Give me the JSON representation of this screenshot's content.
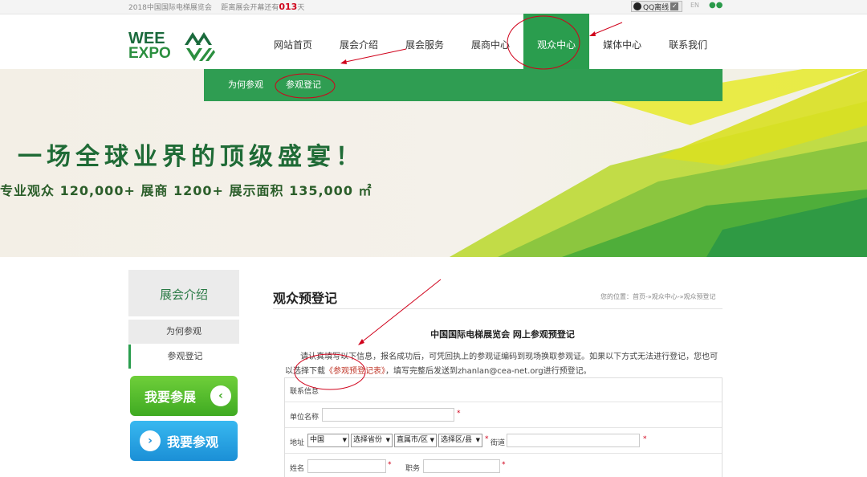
{
  "topbar": {
    "site_name": "2018中国国际电梯展览会",
    "countdown_prefix": "距离展会开幕还有",
    "countdown_value": "013",
    "countdown_suffix": "天",
    "qq_label": "QQ离线",
    "lang_en": "EN"
  },
  "logo": {
    "line1": "WEE",
    "line2": "EXPO"
  },
  "nav": {
    "items": [
      {
        "label": "网站首页"
      },
      {
        "label": "展会介绍"
      },
      {
        "label": "展会服务"
      },
      {
        "label": "展商中心"
      },
      {
        "label": "观众中心",
        "active": true
      },
      {
        "label": "媒体中心"
      },
      {
        "label": "联系我们"
      }
    ]
  },
  "subnav": {
    "items": [
      {
        "label": "为何参观"
      },
      {
        "label": "参观登记"
      }
    ]
  },
  "banner": {
    "slogan": "一场全球业界的顶级盛宴！",
    "stats": "专业观众 120,000+  展商 1200+  展示面积 135,000 ㎡"
  },
  "sidebar": {
    "title": "展会介绍",
    "items": [
      {
        "label": "为何参观"
      },
      {
        "label": "参观登记",
        "active": true
      }
    ],
    "btn_exhibit": "我要参展",
    "btn_visit": "我要参观"
  },
  "main": {
    "title": "观众预登记",
    "breadcrumb": "您的位置：首页-»观众中心-»观众预登记",
    "form_heading": "中国国际电梯展览会 网上参观预登记",
    "intro_part1": "请认真填写以下信息，报名成功后，可凭回执上的参观证编码到现场换取参观证。如果以下方式无法进行登记，您也可以选择下载",
    "intro_link": "《参观预登记表》",
    "intro_part2": "，填写完整后发送到zhanlan@cea-net.org进行预登记。"
  },
  "form": {
    "section_label": "联系信息",
    "company_label": "单位名称",
    "address_label": "地址",
    "country_value": "中国",
    "province_value": "选择省份",
    "city_value": "直属市/区",
    "district_value": "选择区/县",
    "street_label": "街道",
    "name_label": "姓名",
    "position_label": "职务",
    "required_mark": "*"
  },
  "colors": {
    "brand_green": "#2a9d4e",
    "dark_green": "#1a6a3c",
    "annotation_red": "#d0021b",
    "btn_green": "#4fb82a",
    "btn_blue": "#1f9ade"
  }
}
